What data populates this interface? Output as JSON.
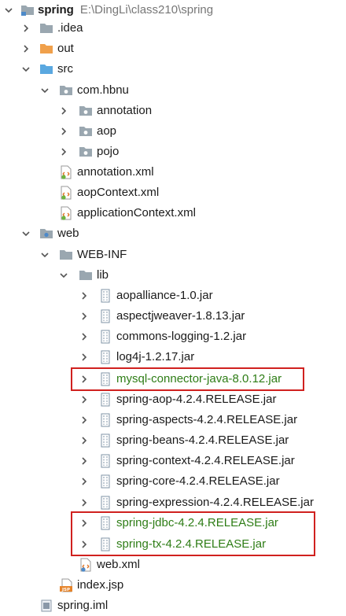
{
  "project": {
    "name": "spring",
    "path": "E:\\DingLi\\class210\\spring"
  },
  "nodes": {
    "idea": ".idea",
    "out": "out",
    "src": "src",
    "pkg": "com.hbnu",
    "annotation_pkg": "annotation",
    "aop_pkg": "aop",
    "pojo_pkg": "pojo",
    "annotation_xml": "annotation.xml",
    "aop_xml": "aopContext.xml",
    "app_xml": "applicationContext.xml",
    "web": "web",
    "webinf": "WEB-INF",
    "lib": "lib",
    "jars": [
      "aopalliance-1.0.jar",
      "aspectjweaver-1.8.13.jar",
      "commons-logging-1.2.jar",
      "log4j-1.2.17.jar",
      "mysql-connector-java-8.0.12.jar",
      "spring-aop-4.2.4.RELEASE.jar",
      "spring-aspects-4.2.4.RELEASE.jar",
      "spring-beans-4.2.4.RELEASE.jar",
      "spring-context-4.2.4.RELEASE.jar",
      "spring-core-4.2.4.RELEASE.jar",
      "spring-expression-4.2.4.RELEASE.jar",
      "spring-jdbc-4.2.4.RELEASE.jar",
      "spring-tx-4.2.4.RELEASE.jar"
    ],
    "web_xml": "web.xml",
    "index_jsp": "index.jsp",
    "iml": "spring.iml"
  },
  "icon_badges": {
    "jsp": "JSP"
  },
  "colors": {
    "highlight": "#d0211f",
    "added_text": "#2e7d16",
    "folder": "#9aa7b0",
    "out_folder": "#f0a04b",
    "src_folder": "#5aa8e0"
  }
}
